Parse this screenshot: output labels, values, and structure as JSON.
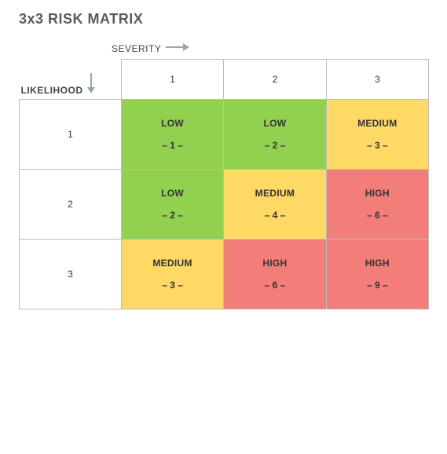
{
  "title": "3x3 RISK MATRIX",
  "axes": {
    "severity_label": "SEVERITY",
    "likelihood_label": "LIKELIHOOD"
  },
  "colors": {
    "low": "#92d050",
    "medium": "#ffd966",
    "high": "#f37e79",
    "arrow": "#9aa6b2",
    "title": "#5b5b5b"
  },
  "severity_headers": [
    "1",
    "2",
    "3"
  ],
  "likelihood_headers": [
    "1",
    "2",
    "3"
  ],
  "cells": [
    [
      {
        "label": "LOW",
        "score": "– 1 –",
        "level": "low"
      },
      {
        "label": "LOW",
        "score": "– 2 –",
        "level": "low"
      },
      {
        "label": "MEDIUM",
        "score": "– 3 –",
        "level": "medium"
      }
    ],
    [
      {
        "label": "LOW",
        "score": "– 2 –",
        "level": "low"
      },
      {
        "label": "MEDIUM",
        "score": "– 4 –",
        "level": "medium"
      },
      {
        "label": "HIGH",
        "score": "– 6 –",
        "level": "high"
      }
    ],
    [
      {
        "label": "MEDIUM",
        "score": "– 3 –",
        "level": "medium"
      },
      {
        "label": "HIGH",
        "score": "– 6 –",
        "level": "high"
      },
      {
        "label": "HIGH",
        "score": "– 9 –",
        "level": "high"
      }
    ]
  ],
  "chart_data": {
    "type": "heatmap",
    "title": "3x3 RISK MATRIX",
    "xlabel": "SEVERITY",
    "ylabel": "LIKELIHOOD",
    "x_categories": [
      1,
      2,
      3
    ],
    "y_categories": [
      1,
      2,
      3
    ],
    "values": [
      [
        1,
        2,
        3
      ],
      [
        2,
        4,
        6
      ],
      [
        3,
        6,
        9
      ]
    ],
    "levels": [
      [
        "LOW",
        "LOW",
        "MEDIUM"
      ],
      [
        "LOW",
        "MEDIUM",
        "HIGH"
      ],
      [
        "MEDIUM",
        "HIGH",
        "HIGH"
      ]
    ],
    "level_colors": {
      "LOW": "#92d050",
      "MEDIUM": "#ffd966",
      "HIGH": "#f37e79"
    }
  }
}
